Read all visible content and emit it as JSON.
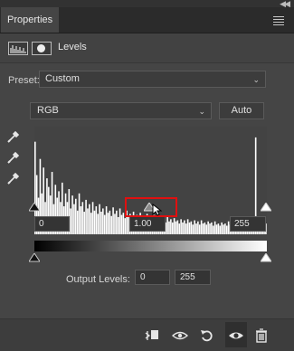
{
  "panel": {
    "tab_label": "Properties"
  },
  "layer": {
    "title": "Levels"
  },
  "preset": {
    "label": "Preset:",
    "value": "Custom"
  },
  "channel": {
    "value": "RGB"
  },
  "auto_button": {
    "label": "Auto"
  },
  "input_levels": {
    "shadow": "0",
    "midtone": "1.00",
    "highlight": "255"
  },
  "output_levels": {
    "label": "Output Levels:",
    "low": "0",
    "high": "255"
  },
  "histogram": {
    "values": [
      0.86,
      0.55,
      0.34,
      0.7,
      0.38,
      0.62,
      0.3,
      0.52,
      0.44,
      0.36,
      0.58,
      0.28,
      0.46,
      0.34,
      0.4,
      0.3,
      0.48,
      0.26,
      0.38,
      0.3,
      0.42,
      0.24,
      0.36,
      0.28,
      0.33,
      0.22,
      0.38,
      0.26,
      0.3,
      0.21,
      0.32,
      0.24,
      0.28,
      0.2,
      0.3,
      0.22,
      0.26,
      0.19,
      0.28,
      0.21,
      0.24,
      0.18,
      0.26,
      0.2,
      0.22,
      0.17,
      0.25,
      0.19,
      0.22,
      0.16,
      0.24,
      0.18,
      0.2,
      0.15,
      0.22,
      0.17,
      0.19,
      0.14,
      0.21,
      0.16,
      0.18,
      0.14,
      0.2,
      0.15,
      0.17,
      0.13,
      0.19,
      0.14,
      0.16,
      0.12,
      0.18,
      0.14,
      0.15,
      0.12,
      0.17,
      0.13,
      0.15,
      0.11,
      0.16,
      0.12,
      0.14,
      0.11,
      0.15,
      0.12,
      0.13,
      0.1,
      0.14,
      0.11,
      0.13,
      0.1,
      0.14,
      0.11,
      0.12,
      0.09,
      0.13,
      0.1,
      0.12,
      0.09,
      0.13,
      0.1,
      0.11,
      0.09,
      0.12,
      0.1,
      0.11,
      0.08,
      0.12,
      0.09,
      0.1,
      0.08,
      0.11,
      0.09,
      0.1,
      0.08,
      0.12,
      0.09,
      0.1,
      0.08,
      0.13,
      0.1,
      0.11,
      0.09,
      0.14,
      0.1,
      0.12,
      0.1,
      0.15,
      0.11,
      0.13,
      0.1,
      0.9,
      0.12,
      0.1,
      0.14,
      0.11,
      0.12,
      0.1
    ],
    "bar_color": "#ffffff"
  },
  "icons": {
    "eyedroppers": [
      "shadow-eyedropper-icon",
      "midtone-eyedropper-icon",
      "highlight-eyedropper-icon"
    ],
    "bottom": [
      "clip-to-layer-icon",
      "view-previous-state-icon",
      "reset-icon",
      "visibility-eye-icon",
      "trash-icon"
    ]
  },
  "colors": {
    "panel_bg": "#454545",
    "highlight_box": "#e01010"
  }
}
